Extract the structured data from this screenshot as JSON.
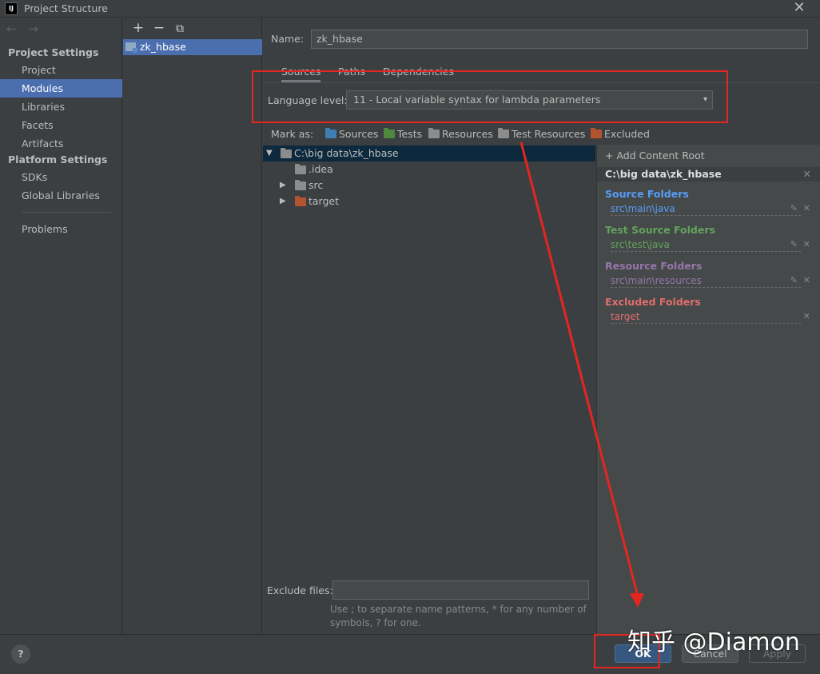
{
  "window": {
    "title": "Project Structure",
    "app_icon_text": "IJ",
    "close_glyph": "✕"
  },
  "nav": {
    "back_glyph": "←",
    "forward_glyph": "→",
    "project_settings_header": "Project Settings",
    "platform_settings_header": "Platform Settings",
    "items": {
      "project": "Project",
      "modules": "Modules",
      "libraries": "Libraries",
      "facets": "Facets",
      "artifacts": "Artifacts",
      "sdks": "SDKs",
      "global_libraries": "Global Libraries",
      "problems": "Problems"
    },
    "selected": "modules"
  },
  "modules_panel": {
    "add_glyph": "+",
    "remove_glyph": "−",
    "copy_glyph": "⧉",
    "module_name": "zk_hbase"
  },
  "module": {
    "name_label": "Name:",
    "name_value": "zk_hbase",
    "tabs": [
      "Sources",
      "Paths",
      "Dependencies"
    ],
    "active_tab": "Sources",
    "language_level_label": "Language level:",
    "language_level_value": "11 - Local variable syntax for lambda parameters",
    "chevron_glyph": "▾"
  },
  "mark_as": {
    "label": "Mark as:",
    "items": [
      {
        "label": "Sources",
        "color": "#3d7eb3"
      },
      {
        "label": "Tests",
        "color": "#4e8a3e"
      },
      {
        "label": "Resources",
        "color": "#8c8c8c"
      },
      {
        "label": "Test Resources",
        "color": "#8c8c8c"
      },
      {
        "label": "Excluded",
        "color": "#b3532f"
      }
    ]
  },
  "tree": {
    "expanded_glyph": "▼",
    "collapsed_glyph": "▶",
    "root": "C:\\big data\\zk_hbase",
    "children": [
      {
        "name": ".idea",
        "color": "#8c8c8c",
        "expandable": false
      },
      {
        "name": "src",
        "color": "#8c8c8c",
        "expandable": true
      },
      {
        "name": "target",
        "color": "#b3532f",
        "expandable": true
      }
    ]
  },
  "content_root": {
    "add_label": "+ Add Content Root",
    "root_path": "C:\\big data\\zk_hbase",
    "edit_glyph": "✎",
    "remove_glyph": "✕",
    "groups": [
      {
        "title": "Source Folders",
        "path": "src\\main\\java",
        "color": "#589df6",
        "path_color": "#589df6",
        "editable": true
      },
      {
        "title": "Test Source Folders",
        "path": "src\\test\\java",
        "color": "#62a35c",
        "path_color": "#62a35c",
        "editable": true
      },
      {
        "title": "Resource Folders",
        "path": "src\\main\\resources",
        "color": "#9876aa",
        "path_color": "#9876aa",
        "editable": true
      },
      {
        "title": "Excluded Folders",
        "path": "target",
        "color": "#e06c6c",
        "path_color": "#e06c6c",
        "editable": false
      }
    ]
  },
  "exclude": {
    "label": "Exclude files:",
    "value": "",
    "hint": "Use ; to separate name patterns, * for any number of symbols, ? for one."
  },
  "footer": {
    "help_label": "?",
    "ok_label": "OK",
    "cancel_label": "Cancel",
    "apply_label": "Apply"
  },
  "watermark": "知乎 @Diamon"
}
